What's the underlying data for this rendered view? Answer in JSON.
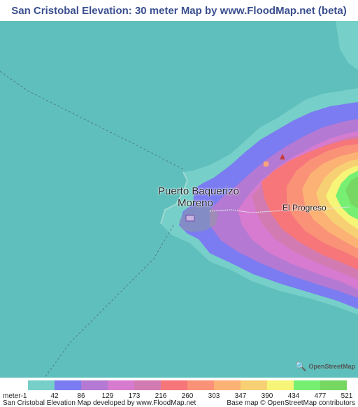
{
  "title": "San Cristobal Elevation: 30 meter Map by www.FloodMap.net (beta)",
  "map": {
    "labels": {
      "town_line1": "Puerto Baquerizo",
      "town_line2": "Moreno",
      "village": "El Progreso"
    },
    "osm_logo_text": "OpenStreetMap",
    "sea_color": "#5fbfbc",
    "land_color": "#8d9aa0"
  },
  "legend": {
    "unit_label": "meter",
    "first_value": "-1",
    "ticks": [
      "42",
      "86",
      "129",
      "173",
      "216",
      "260",
      "303",
      "347",
      "390",
      "434",
      "477",
      "521"
    ],
    "colors": [
      "#76cfc8",
      "#7b7bf2",
      "#b47ad3",
      "#d77bd0",
      "#d27bb3",
      "#f7767a",
      "#f99277",
      "#fbb274",
      "#f8d074",
      "#f7f578",
      "#76ef72",
      "#77d763"
    ]
  },
  "footer": {
    "left": "San Cristobal Elevation Map developed by www.FloodMap.net",
    "right": "Base map © OpenStreetMap contributors"
  }
}
